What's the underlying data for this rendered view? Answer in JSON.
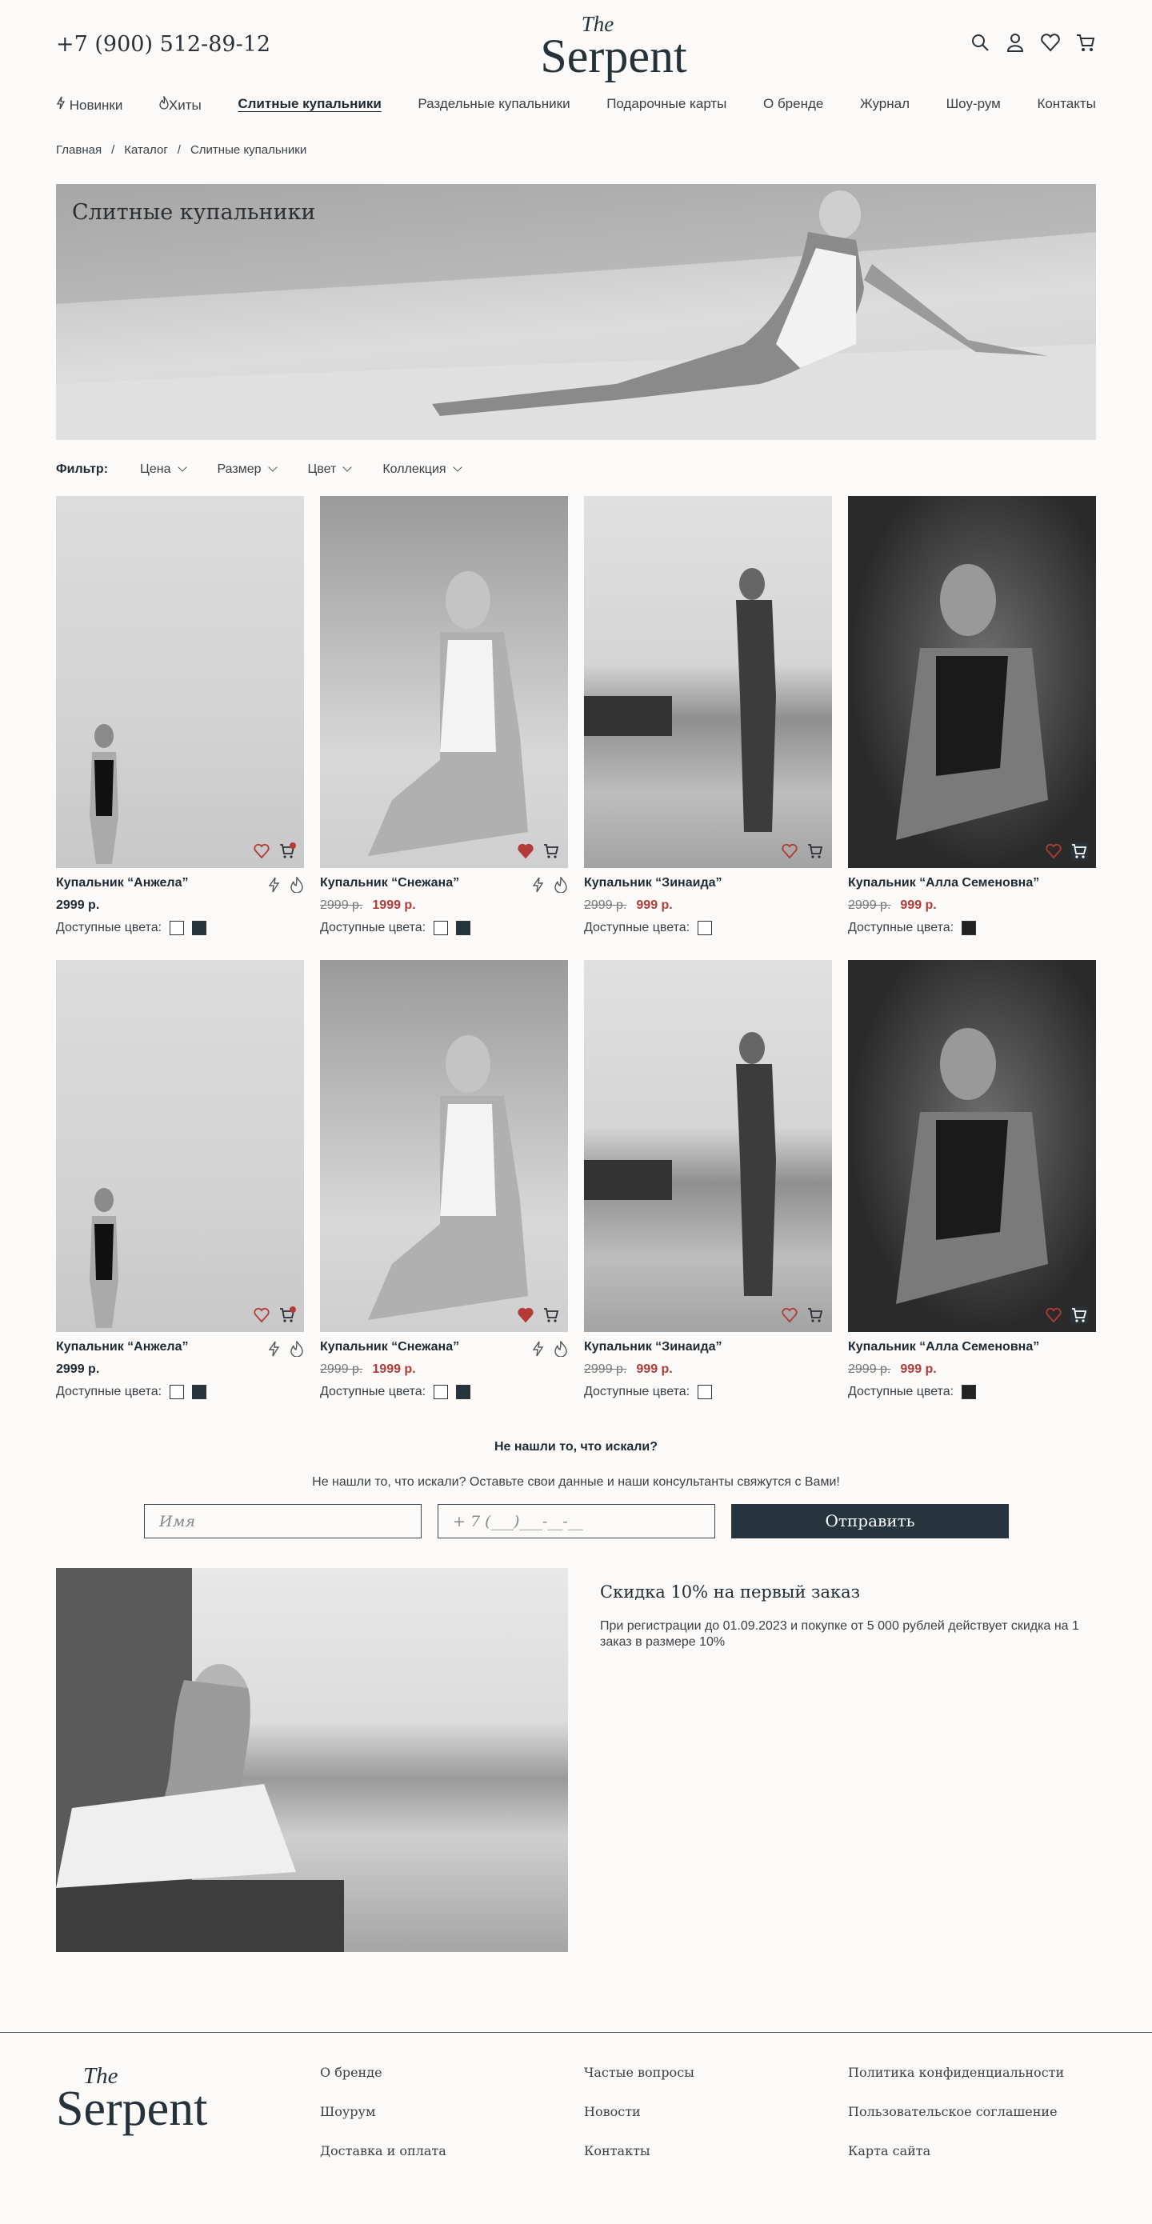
{
  "header": {
    "phone": "+7 (900) 512-89-12",
    "logo_the": "The",
    "logo_name": "Serpent"
  },
  "nav": [
    "Новинки",
    "Хиты",
    "Слитные купальники",
    "Раздельные купальники",
    "Подарочные карты",
    "О бренде",
    "Журнал",
    "Шоу-рум",
    "Контакты"
  ],
  "breadcrumb": [
    "Главная",
    "Каталог",
    "Слитные купальники"
  ],
  "hero": {
    "title": "Слитные купальники"
  },
  "filters": {
    "label": "Фильтр:",
    "items": [
      "Цена",
      "Размер",
      "Цвет",
      "Коллекция"
    ]
  },
  "products": [
    {
      "name": "Купальник “Анжела”",
      "old_price": "",
      "price": "2999 р.",
      "colors_label": "Доступные цвета:",
      "swatches": [
        "#ffffff",
        "#26343e"
      ],
      "favorite": false,
      "cart_badge": "1",
      "marks": true
    },
    {
      "name": "Купальник “Снежана”",
      "old_price": "2999 р.",
      "price": "1999 р.",
      "colors_label": "Доступные цвета:",
      "swatches": [
        "#ffffff",
        "#26343e"
      ],
      "favorite": true,
      "cart_badge": "",
      "marks": true
    },
    {
      "name": "Купальник “Зинаида”",
      "old_price": "2999 р.",
      "price": "999 р.",
      "colors_label": "Доступные цвета:",
      "swatches": [
        "#ffffff"
      ],
      "favorite": false,
      "cart_badge": "",
      "marks": false
    },
    {
      "name": "Купальник “Алла Семеновна”",
      "old_price": "2999 р.",
      "price": "999 р.",
      "colors_label": "Доступные цвета:",
      "swatches": [
        "#222222"
      ],
      "favorite": false,
      "cart_badge": "",
      "marks": false
    }
  ],
  "notfound": {
    "title": "Не нашли то, что искали?",
    "subtitle": "Не нашли то, что искали? Оставьте свои данные и наши консультанты свяжутся с Вами!",
    "name_placeholder": "Имя",
    "phone_placeholder": "+ 7 (___)___-__-__",
    "submit": "Отправить"
  },
  "promo": {
    "title": "Скидка 10% на первый заказ",
    "text": "При регистрации до 01.09.2023 и покупке от 5 000 рублей действует скидка на 1 заказ в размере 10%"
  },
  "footer": {
    "logo_the": "The",
    "logo_name": "Serpent",
    "col1": [
      "О бренде",
      "Шоурум",
      "Доставка и оплата"
    ],
    "col2": [
      "Частые вопросы",
      "Новости",
      "Контакты"
    ],
    "col3": [
      "Политика конфиденциальности",
      "Пользовательское соглашение",
      "Карта сайта"
    ]
  },
  "colors": {
    "accent": "#26343e",
    "sale": "#b33a37",
    "favorite": "#b33a37"
  }
}
